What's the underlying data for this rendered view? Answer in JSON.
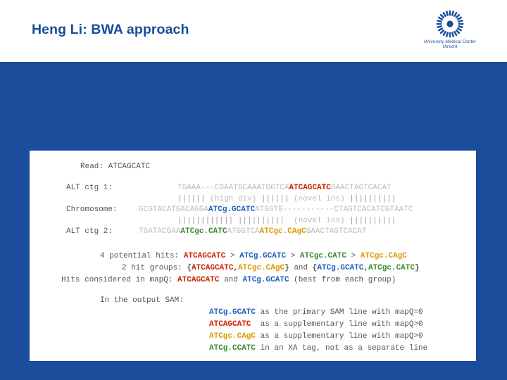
{
  "slide": {
    "title": "Heng Li: BWA approach",
    "background_color": "#1a4d9c",
    "header_background": "#ffffff"
  },
  "logo": {
    "name": "university-medical-center-utrecht-logo",
    "line1": "University Medical Center",
    "line2": "Utrecht",
    "color": "#1a4d9c"
  },
  "figure": {
    "read": {
      "label": "Read:",
      "sequence": "ATCAGCATC"
    },
    "alt_ctg_1": {
      "label": "ALT ctg 1:",
      "prefix": "TGAAA---CGAATGCAAATGGTCA",
      "highlight": "ATCAGCATC",
      "suffix": "GAACTAGTCACAT"
    },
    "align_bar_1": {
      "left_bars": "||||||",
      "left_note": "(high div)",
      "mid_bars": "||||||",
      "right_note": "(novel ins)",
      "right_bars": "||||||||||"
    },
    "chromosome": {
      "label": "Chromosome:",
      "prefix": "GCGTACATGACAGGA",
      "highlight": "ATCg.GCATC",
      "suffix": "ATGGTG-----------CTAGTCACATCGTAATC"
    },
    "align_bar_2": {
      "left_bars": "||||||||||||",
      "mid_bars": "||||||||||",
      "right_note": "(novel ins)",
      "right_bars": "||||||||||"
    },
    "alt_ctg_2": {
      "label": "ALT ctg 2:",
      "prefix": "TGATACGAA",
      "highlight1": "ATCgc.CATC",
      "mid": "ATGGTCA",
      "highlight2": "ATCgc.CAgC",
      "suffix": "GAACTAGTCACAT"
    },
    "hits_line_1": {
      "label": "4 potential hits:",
      "h1": "ATCAGCATC",
      "op1": ">",
      "h2": "ATCg.GCATC",
      "op2": ">",
      "h3": "ATCgc.CATC",
      "op3": ">",
      "h4": "ATCgc.CAgC"
    },
    "hits_line_2": {
      "label": "2 hit groups:",
      "group1_open": "{",
      "g1a": "ATCAGCATC",
      "g1comma": ",",
      "g1b": "ATCgc.CAgC",
      "group1_close": "}",
      "and": "and",
      "group2_open": "{",
      "g2a": "ATCg.GCATC",
      "g2comma": ",",
      "g2b": "ATCgc.CATC",
      "group2_close": "}"
    },
    "hits_line_3": {
      "label": "Hits considered in mapQ:",
      "h1": "ATCAGCATC",
      "and": "and",
      "h2": "ATCg.GCATC",
      "note": "(best from each group)"
    },
    "output": {
      "intro": "In the output SAM:",
      "lines": [
        {
          "seq": "ATCg.GCATC",
          "seq_class": "blue",
          "text": "as the primary SAM line with mapQ=0"
        },
        {
          "seq": "ATCAGCATC",
          "seq_class": "red",
          "text": "as a supplementary line with mapQ>0"
        },
        {
          "seq": "ATCgc.CAgC",
          "seq_class": "orange",
          "text": "as a supplementary line with mapQ>0"
        },
        {
          "seq": "ATCg.CCATC",
          "seq_class": "green",
          "text": "in an XA tag, not as a separate line"
        }
      ]
    }
  },
  "colors": {
    "accent_blue": "#1a4d9c",
    "seq_red": "#cc2200",
    "seq_blue": "#1c5fc1",
    "seq_green": "#3b8a2e",
    "seq_orange": "#d99a00",
    "faded_grey": "#bcbcbc"
  }
}
